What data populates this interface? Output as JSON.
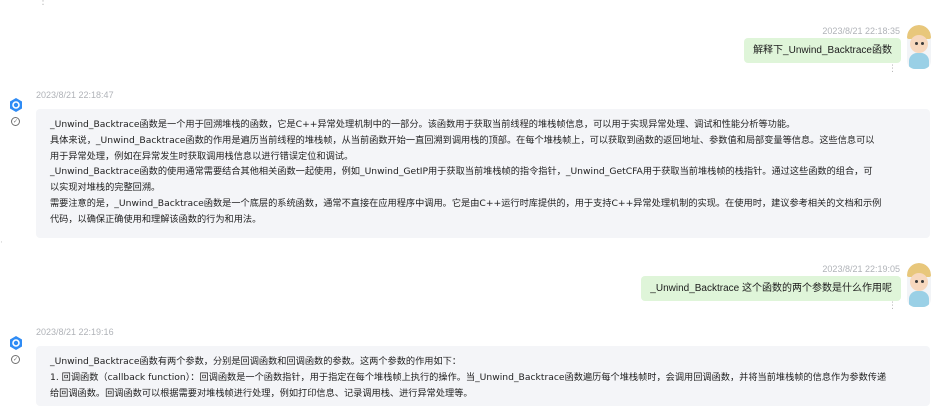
{
  "messages": {
    "m1": {
      "timestamp": "2023/8/21 22:18:35",
      "text": "解释下_Unwind_Backtrace函数"
    },
    "m2": {
      "timestamp": "2023/8/21 22:18:47",
      "lines": [
        "_Unwind_Backtrace函数是一个用于回溯堆栈的函数，它是C++异常处理机制中的一部分。该函数用于获取当前线程的堆栈帧信息，可以用于实现异常处理、调试和性能分析等功能。",
        "具体来说，_Unwind_Backtrace函数的作用是遍历当前线程的堆栈帧，从当前函数开始一直回溯到调用栈的顶部。在每个堆栈帧上，可以获取到函数的返回地址、参数值和局部变量等信息。这些信息可以",
        "用于异常处理，例如在异常发生时获取调用栈信息以进行错误定位和调试。",
        "_Unwind_Backtrace函数的使用通常需要结合其他相关函数一起使用，例如_Unwind_GetIP用于获取当前堆栈帧的指令指针，_Unwind_GetCFA用于获取当前堆栈帧的栈指针。通过这些函数的组合，可",
        "以实现对堆栈的完整回溯。",
        "需要注意的是，_Unwind_Backtrace函数是一个底层的系统函数，通常不直接在应用程序中调用。它是由C++运行时库提供的，用于支持C++异常处理机制的实现。在使用时，建议参考相关的文档和示例",
        "代码，以确保正确使用和理解该函数的行为和用法。"
      ]
    },
    "m3": {
      "timestamp": "2023/8/21 22:19:05",
      "text": "_Unwind_Backtrace 这个函数的两个参数是什么作用呢"
    },
    "m4": {
      "timestamp": "2023/8/21 22:19:16",
      "lines": [
        "_Unwind_Backtrace函数有两个参数，分别是回调函数和回调函数的参数。这两个参数的作用如下：",
        "1. 回调函数（callback function）：回调函数是一个函数指针，用于指定在每个堆栈帧上执行的操作。当_Unwind_Backtrace函数遍历每个堆栈帧时，会调用回调函数，并将当前堆栈帧的信息作为参数传递",
        "给回调函数。回调函数可以根据需要对堆栈帧进行处理，例如打印信息、记录调用栈、进行异常处理等。"
      ]
    }
  },
  "icons": {
    "more": "more-vertical-icon",
    "bot": "bot-hexagon-icon",
    "check": "check-circle-icon",
    "avatar": "user-avatar"
  },
  "colors": {
    "user_bubble": "#dff5d9",
    "bot_bubble": "#f4f5f8",
    "bot_icon": "#2f8cf5",
    "timestamp": "#b0b3b8"
  }
}
